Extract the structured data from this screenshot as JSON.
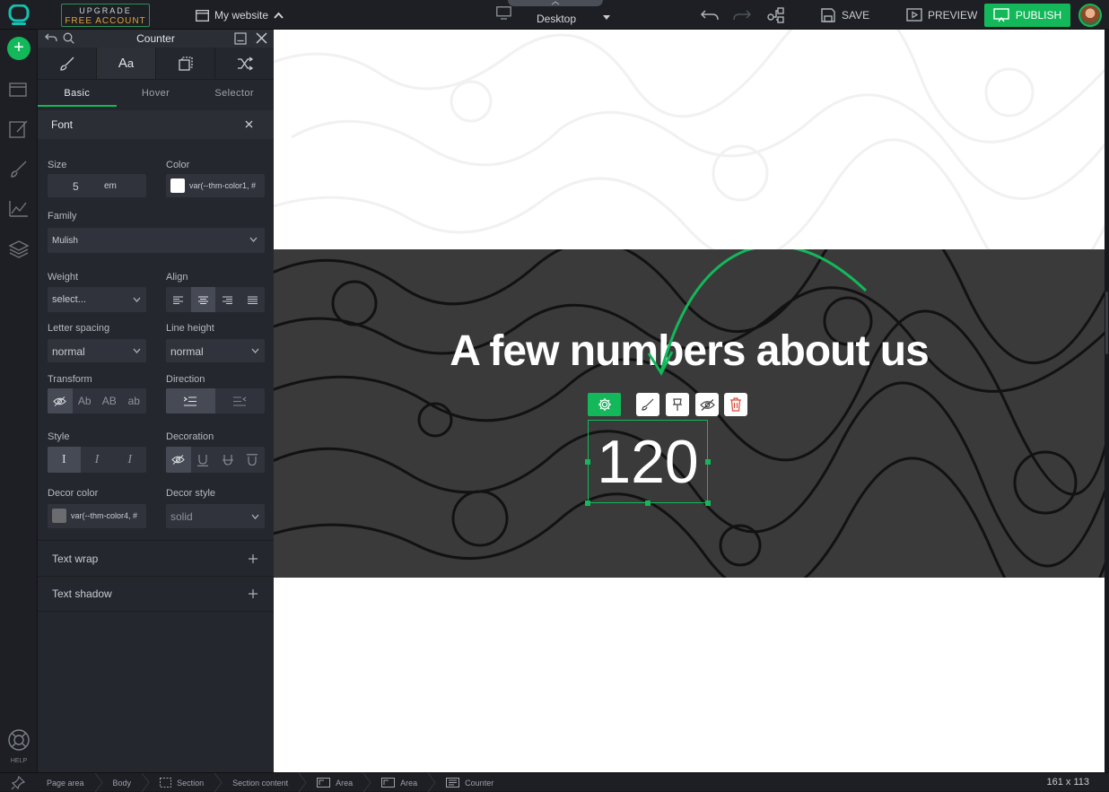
{
  "topbar": {
    "upgrade_line1": "UPGRADE",
    "upgrade_line2": "FREE ACCOUNT",
    "site_name": "My website",
    "device": "Desktop",
    "save_label": "SAVE",
    "preview_label": "PREVIEW",
    "publish_label": "PUBLISH"
  },
  "rail": {
    "help_label": "HELP"
  },
  "panel": {
    "title": "Counter",
    "tabs": [
      "brush-icon",
      "typography-icon",
      "layers-icon",
      "shuffle-icon"
    ],
    "subtabs": [
      "Basic",
      "Hover",
      "Selector"
    ],
    "section_title": "Font",
    "size_label": "Size",
    "size_value": "5",
    "size_unit": "em",
    "color_label": "Color",
    "color_value": "var(--thm-color1, #",
    "family_label": "Family",
    "family_value": "Mulish",
    "weight_label": "Weight",
    "weight_value": "select...",
    "align_label": "Align",
    "letter_spacing_label": "Letter spacing",
    "letter_spacing_value": "normal",
    "line_height_label": "Line height",
    "line_height_value": "normal",
    "transform_label": "Transform",
    "transform_options": [
      "Ab",
      "AB",
      "ab"
    ],
    "direction_label": "Direction",
    "style_label": "Style",
    "style_options": [
      "I",
      "I",
      "I"
    ],
    "decoration_label": "Decoration",
    "decor_color_label": "Decor color",
    "decor_color_value": "var(--thm-color4, #",
    "decor_style_label": "Decor style",
    "decor_style_value": "solid",
    "text_wrap_label": "Text wrap",
    "text_shadow_label": "Text shadow"
  },
  "canvas": {
    "heading": "A few numbers about us",
    "counter_value": "120"
  },
  "colors": {
    "accent": "#13b85a",
    "panel_bg": "#24272d",
    "danger": "#e04a3a"
  },
  "statusbar": {
    "crumbs": [
      "Page area",
      "Body",
      "Section",
      "Section content",
      "Area",
      "Area",
      "Counter"
    ],
    "size_readout": "161 x 113"
  }
}
